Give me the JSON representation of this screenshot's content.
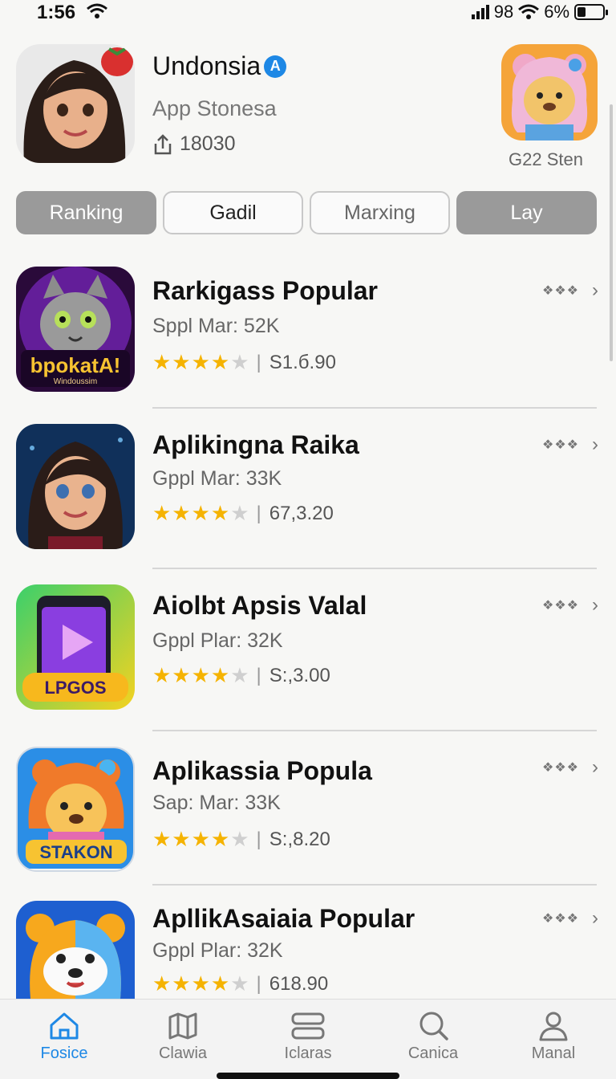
{
  "status_bar": {
    "time": "1:56",
    "carrier": "98",
    "battery": "6%"
  },
  "header": {
    "title": "Undonsia",
    "verified_badge": "A",
    "subtitle": "App Stonesa",
    "count": "18030",
    "side_label": "G22 Sten"
  },
  "tabs": [
    {
      "label": "Ranking",
      "style": "filled"
    },
    {
      "label": "Gadil",
      "style": "outline"
    },
    {
      "label": "Marxing",
      "style": "outline"
    },
    {
      "label": "Lay",
      "style": "filled"
    }
  ],
  "apps": [
    {
      "name": "Rarkigass Popular",
      "meta": "Sppl Mar: 52K",
      "rating": 4.5,
      "price": "S1.б.90",
      "icon_text": "bpokatA!",
      "icon_subtext": "Windoussim",
      "more": "❖❖❖"
    },
    {
      "name": "Aplikingna Raika",
      "meta": "Gppl Mar: 33K",
      "rating": 4.5,
      "price": "67,3.20",
      "more": "❖❖❖"
    },
    {
      "name": "Aiolbt Apsis Valal",
      "meta": "Gppl Plar: 32K",
      "rating": 4.5,
      "price": "S:,3.00",
      "icon_text": "LPGOS",
      "more": "❖❖❖"
    },
    {
      "name": "Aplikassia Popula",
      "meta": "Sap: Mar: 33K",
      "rating": 4.5,
      "price": "S:,8.20",
      "icon_text": "STAKON",
      "more": "❖❖❖"
    },
    {
      "name": "ApllikAsaiaia Popular",
      "meta": "Gppl Plar: 32K",
      "rating": 4.5,
      "price": "618.90",
      "more": "❖❖❖"
    }
  ],
  "tab_bar": [
    {
      "label": "Fosice",
      "icon": "home-icon",
      "active": true
    },
    {
      "label": "Clawia",
      "icon": "map-icon",
      "active": false
    },
    {
      "label": "Iclaras",
      "icon": "stack-icon",
      "active": false
    },
    {
      "label": "Canica",
      "icon": "search-icon",
      "active": false
    },
    {
      "label": "Manal",
      "icon": "person-icon",
      "active": false
    }
  ],
  "colors": {
    "accent": "#1e88e5",
    "star": "#f5b301",
    "tab_filled": "#9a9a9a"
  }
}
